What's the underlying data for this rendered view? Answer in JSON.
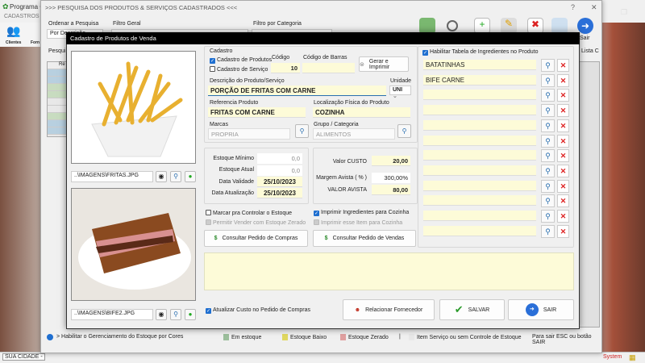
{
  "app": {
    "title": "Programa C",
    "menu": "CADASTROS",
    "icons": [
      "Clientes",
      "Forn"
    ],
    "status_city": "SUA CIDADE -",
    "status_system": "System"
  },
  "search_window": {
    "title": ">>> PESQUISA DOS PRODUTOS & SERVIÇOS CADASTRADOS <<<",
    "order_label": "Ordenar a Pesquisa",
    "order_value": "Por Descrição",
    "filter_label": "Filtro Geral",
    "category_label": "Filtro por Categoria",
    "search_label": "Pesqui",
    "sair_label": "Sair",
    "lista_label": "Lista C",
    "grid_header": "Re",
    "help": "?",
    "close": "✕",
    "legend": {
      "habilitar": "> Habilitar o Gerenciamento do Estoque por Cores",
      "em_estoque": "Em estoque",
      "baixo": "Estoque Baixo",
      "zerado": "Estoque Zerado",
      "sep": "|",
      "servico": "Item Serviço ou sem Controle de Estoque",
      "sair_hint": "Para sair ESC ou botão SAIR"
    },
    "legend_colors": {
      "em_estoque": "#9cbf9c",
      "baixo": "#e0d860",
      "zerado": "#e0a0a0",
      "servico": "#e8e8e8"
    }
  },
  "modal": {
    "title": "Cadastro de Produtos de Venda",
    "image1_path": "..\\IMAGENS\\FRITAS.JPG",
    "image2_path": "..\\IMAGENS\\BIFE2.JPG",
    "cadastro_label": "Cadastro",
    "cadastro_produtos": "Cadastro de Produtos",
    "cadastro_servico": "Cadastro de Serviço",
    "codigo_label": "Código",
    "codigo": "10",
    "barras_label": "Código de Barras",
    "barras": "",
    "gerar_label": "Gerar e Imprimir",
    "descricao_label": "Descrição do Produto/Serviço",
    "descricao": "PORÇÃO DE FRITAS COM CARNE",
    "unidade_label": "Unidade",
    "unidade": "UNI",
    "referencia_label": "Referencia Produto",
    "referencia": "FRITAS COM CARNE",
    "localizacao_label": "Localização Física do Produto",
    "localizacao": "COZINHA",
    "marcas_label": "Marcas",
    "marcas": "PROPRIA",
    "grupo_label": "Grupo / Categoria",
    "grupo": "ALIMENTOS",
    "estoque_minimo_label": "Estoque Mínimo",
    "estoque_minimo": "0,0",
    "estoque_atual_label": "Estoque Atual",
    "estoque_atual": "0,0",
    "data_validade_label": "Data Validade",
    "data_validade": "25/10/2023",
    "data_atualizacao_label": "Data Atualização",
    "data_atualizacao": "25/10/2023",
    "valor_custo_label": "Valor CUSTO",
    "valor_custo": "20,00",
    "margem_label": "Margem Avista ( % )",
    "margem": "300,00%",
    "valor_avista_label": "VALOR AVISTA",
    "valor_avista": "80,00",
    "controlar_estoque": "Marcar pra Controlar o Estoque",
    "permitir_zerado": "Permitir Vender com Estoque Zerado",
    "imprimir_ingredientes": "Imprimir Ingredientes para Cozinha",
    "imprimir_item": "Imprimir esse Item para Cozinha",
    "consultar_compras": "Consultar Pedido de Compras",
    "consultar_vendas": "Consultar Pedido de Vendas",
    "habilitar_ingredientes": "Habilitar Tabela de Ingredientes no Produto",
    "ingredientes": [
      "BATATINHAS",
      "BIFE CARNE",
      "",
      "",
      "",
      "",
      "",
      "",
      "",
      "",
      "",
      ""
    ],
    "observacoes": "",
    "atualizar_custo": "Atualizar Custo no Pedido de Compras",
    "relacionar_fornecedor": "Relacionar Fornecedor",
    "salvar": "SALVAR",
    "sair": "SAIR"
  }
}
